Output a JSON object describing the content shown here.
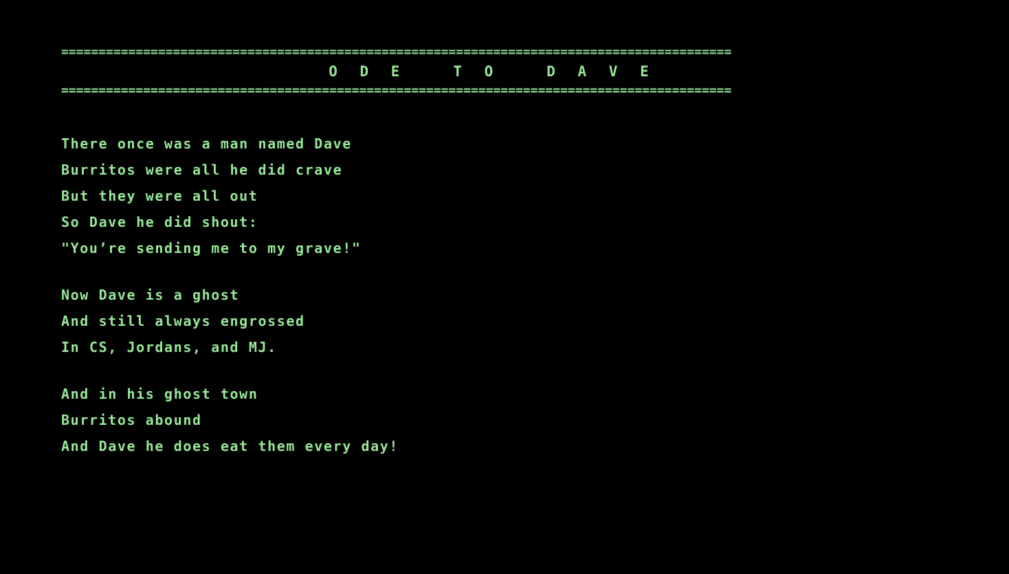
{
  "header": {
    "rule": "==========================================================================================",
    "title": "O D E   T O   D A V E"
  },
  "poem": {
    "stanzas": [
      {
        "lines": [
          "There once was a man named Dave",
          "Burritos were all he did crave",
          "But they were all out",
          "So Dave he did shout:",
          "\"You’re sending me to my grave!\""
        ]
      },
      {
        "lines": [
          "Now Dave is a ghost",
          "And still always engrossed",
          "In CS, Jordans, and MJ."
        ]
      },
      {
        "lines": [
          "And in his ghost town",
          "Burritos abound",
          "And Dave he does eat them every day!"
        ]
      }
    ]
  },
  "colors": {
    "background": "#000000",
    "text": "#98e898"
  }
}
